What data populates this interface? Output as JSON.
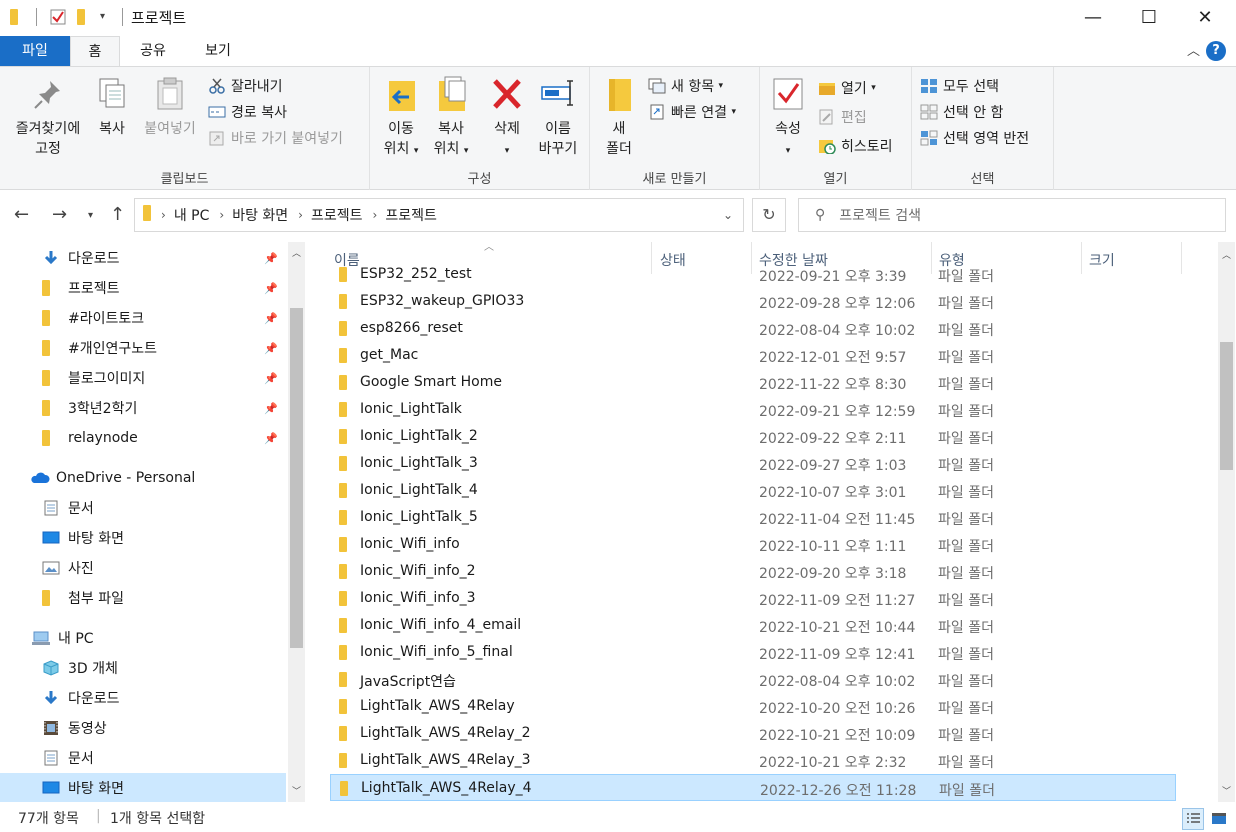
{
  "window": {
    "title": "프로젝트",
    "minimize_glyph": "—",
    "maximize_glyph": "☐",
    "close_glyph": "✕"
  },
  "tabs": {
    "file": "파일",
    "home": "홈",
    "share": "공유",
    "view": "보기",
    "help": "?"
  },
  "ribbon": {
    "clipboard": {
      "label": "클립보드",
      "pin_line1": "즐겨찾기에",
      "pin_line2": "고정",
      "copy": "복사",
      "paste": "붙여넣기",
      "cut": "잘라내기",
      "copy_path": "경로 복사",
      "paste_shortcut": "바로 가기 붙여넣기"
    },
    "organize": {
      "label": "구성",
      "move_line1": "이동",
      "move_line2": "위치",
      "copyto_line1": "복사",
      "copyto_line2": "위치",
      "delete": "삭제",
      "rename_line1": "이름",
      "rename_line2": "바꾸기"
    },
    "new": {
      "label": "새로 만들기",
      "new_folder_line1": "새",
      "new_folder_line2": "폴더",
      "new_item": "새 항목",
      "easy_access": "빠른 연결"
    },
    "open": {
      "label": "열기",
      "properties": "속성",
      "open": "열기",
      "edit": "편집",
      "history": "히스토리"
    },
    "select": {
      "label": "선택",
      "select_all": "모두 선택",
      "select_none": "선택 안 함",
      "invert": "선택 영역 반전"
    }
  },
  "address": {
    "segments": [
      "내 PC",
      "바탕 화면",
      "프로젝트",
      "프로젝트"
    ],
    "search_placeholder": "프로젝트 검색"
  },
  "nav": {
    "quick": [
      {
        "label": "다운로드",
        "icon": "download-icon",
        "pinned": true
      },
      {
        "label": "프로젝트",
        "icon": "folder-icon",
        "pinned": true
      },
      {
        "label": "#라이트토크",
        "icon": "folder-icon",
        "pinned": true
      },
      {
        "label": "#개인연구노트",
        "icon": "folder-icon",
        "pinned": true
      },
      {
        "label": "블로그이미지",
        "icon": "folder-icon",
        "pinned": true
      },
      {
        "label": "3학년2학기",
        "icon": "folder-icon",
        "pinned": true
      },
      {
        "label": "relaynode",
        "icon": "folder-icon",
        "pinned": true
      }
    ],
    "onedrive": {
      "label": "OneDrive - Personal",
      "items": [
        {
          "label": "문서",
          "icon": "document-icon"
        },
        {
          "label": "바탕 화면",
          "icon": "desktop-icon"
        },
        {
          "label": "사진",
          "icon": "pictures-icon"
        },
        {
          "label": "첨부 파일",
          "icon": "folder-icon"
        }
      ]
    },
    "thispc": {
      "label": "내 PC",
      "items": [
        {
          "label": "3D 개체",
          "icon": "3d-objects-icon"
        },
        {
          "label": "다운로드",
          "icon": "download-icon"
        },
        {
          "label": "동영상",
          "icon": "video-icon"
        },
        {
          "label": "문서",
          "icon": "document-icon"
        },
        {
          "label": "바탕 화면",
          "icon": "desktop-icon",
          "selected": true
        }
      ]
    }
  },
  "columns": {
    "name": "이름",
    "status": "상태",
    "modified": "수정한 날짜",
    "type": "유형",
    "size": "크기"
  },
  "files": [
    {
      "name": "ESP32_252_test",
      "date": "2022-09-21 오후 3:39",
      "type": "파일 폴더",
      "partial": true
    },
    {
      "name": "ESP32_wakeup_GPIO33",
      "date": "2022-09-28 오후 12:06",
      "type": "파일 폴더"
    },
    {
      "name": "esp8266_reset",
      "date": "2022-08-04 오후 10:02",
      "type": "파일 폴더"
    },
    {
      "name": "get_Mac",
      "date": "2022-12-01 오전 9:57",
      "type": "파일 폴더"
    },
    {
      "name": "Google Smart Home",
      "date": "2022-11-22 오후 8:30",
      "type": "파일 폴더"
    },
    {
      "name": "Ionic_LightTalk",
      "date": "2022-09-21 오후 12:59",
      "type": "파일 폴더"
    },
    {
      "name": "Ionic_LightTalk_2",
      "date": "2022-09-22 오후 2:11",
      "type": "파일 폴더"
    },
    {
      "name": "Ionic_LightTalk_3",
      "date": "2022-09-27 오후 1:03",
      "type": "파일 폴더"
    },
    {
      "name": "Ionic_LightTalk_4",
      "date": "2022-10-07 오후 3:01",
      "type": "파일 폴더"
    },
    {
      "name": "Ionic_LightTalk_5",
      "date": "2022-11-04 오전 11:45",
      "type": "파일 폴더"
    },
    {
      "name": "Ionic_Wifi_info",
      "date": "2022-10-11 오후 1:11",
      "type": "파일 폴더"
    },
    {
      "name": "Ionic_Wifi_info_2",
      "date": "2022-09-20 오후 3:18",
      "type": "파일 폴더"
    },
    {
      "name": "Ionic_Wifi_info_3",
      "date": "2022-11-09 오전 11:27",
      "type": "파일 폴더"
    },
    {
      "name": "Ionic_Wifi_info_4_email",
      "date": "2022-10-21 오전 10:44",
      "type": "파일 폴더"
    },
    {
      "name": "Ionic_Wifi_info_5_final",
      "date": "2022-11-09 오후 12:41",
      "type": "파일 폴더"
    },
    {
      "name": "JavaScript연습",
      "date": "2022-08-04 오후 10:02",
      "type": "파일 폴더"
    },
    {
      "name": "LightTalk_AWS_4Relay",
      "date": "2022-10-20 오전 10:26",
      "type": "파일 폴더"
    },
    {
      "name": "LightTalk_AWS_4Relay_2",
      "date": "2022-10-21 오전 10:09",
      "type": "파일 폴더"
    },
    {
      "name": "LightTalk_AWS_4Relay_3",
      "date": "2022-10-21 오후 2:32",
      "type": "파일 폴더"
    },
    {
      "name": "LightTalk_AWS_4Relay_4",
      "date": "2022-12-26 오전 11:28",
      "type": "파일 폴더",
      "selected": true
    }
  ],
  "status": {
    "item_count": "77개 항목",
    "selection": "1개 항목 선택함"
  },
  "colors": {
    "accent": "#1a6ec7",
    "selection": "#cce8ff",
    "folder": "#f2c33a",
    "delete_red": "#d9262c"
  }
}
